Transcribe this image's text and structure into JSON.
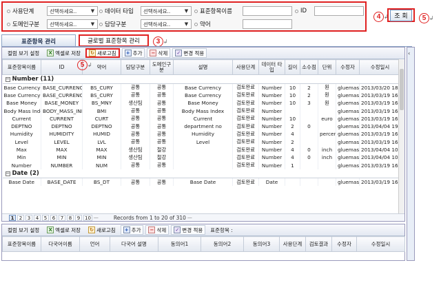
{
  "search": {
    "fields": [
      {
        "label": "사용단계",
        "type": "select",
        "value": "선택하세요.."
      },
      {
        "label": "데이터 타입",
        "type": "select",
        "value": "선택하세요.."
      },
      {
        "label": "표준항목이름",
        "type": "input",
        "value": ""
      },
      {
        "label": "ID",
        "type": "input",
        "value": ""
      },
      {
        "label": "도메인구분",
        "type": "select",
        "value": "선택하세요.."
      },
      {
        "label": "담당구분",
        "type": "select",
        "value": "선택하세요.."
      },
      {
        "label": "약어",
        "type": "input",
        "value": ""
      }
    ],
    "button_label": "조 회"
  },
  "callouts": {
    "c3": "3",
    "c4": "4",
    "c5a": "5",
    "c5b": "5"
  },
  "tabs": {
    "active": "표준항목 관리",
    "global": "글로벌 표준항목 관리"
  },
  "toolbar_top": {
    "view_settings": "컬럼 보기 설정",
    "excel_save": "엑셀로 저장",
    "refresh": "새로고침",
    "add": "추가",
    "delete": "삭제",
    "apply": "변경 적용"
  },
  "columns": [
    "표준항목이름",
    "ID",
    "약어",
    "담당구분",
    "도메인구분",
    "설명",
    "사용단계",
    "데이터 타입",
    "길이",
    "소수점",
    "단위",
    "수정자",
    "수정일시"
  ],
  "groups": [
    {
      "title": "Number (11)",
      "rows": [
        [
          "Base Currency",
          "BASE_CURRENCY",
          "BS_CURY",
          "공통",
          "공통",
          "Base Currency",
          "검토완료",
          "Number",
          "10",
          "2",
          "원",
          "gluemast",
          "2013/03/20 18:5"
        ],
        [
          "Base Currency3",
          "BASE_CURRENCY3",
          "BS_CURY",
          "공통",
          "공통",
          "Base Currency",
          "검토완료",
          "Number",
          "10",
          "2",
          "원",
          "gluemast",
          "2013/03/19 16:5"
        ],
        [
          "Base Money",
          "BASE_MONEY",
          "BS_MNY",
          "생산팀",
          "공통",
          "Base Money",
          "검토완료",
          "Number",
          "10",
          "3",
          "원",
          "gluemast",
          "2013/03/19 16:5"
        ],
        [
          "Body Mass Index",
          "BODY_MASS_INDEX",
          "BMI",
          "공통",
          "공통",
          "Body Mass Index",
          "검토완료",
          "Number",
          "",
          "",
          "",
          "gluemast",
          "2013/03/19 16:5"
        ],
        [
          "Current",
          "CURRENT",
          "CURT",
          "공통",
          "공통",
          "Current",
          "검토완료",
          "Number",
          "10",
          "",
          "euro",
          "gluemast",
          "2013/03/19 16:5"
        ],
        [
          "DEPTNO",
          "DEPTNO",
          "DEPTNO",
          "공통",
          "공통",
          "department no",
          "검토완료",
          "Number",
          "2",
          "0",
          "",
          "gluemast",
          "2013/04/04 19:5"
        ],
        [
          "Humidity",
          "HUMIDITY",
          "HUMID",
          "공통",
          "공통",
          "Humidity",
          "검토완료",
          "Number",
          "4",
          "",
          "percent",
          "gluemast",
          "2013/03/19 16:5"
        ],
        [
          "Level",
          "LEVEL",
          "LVL",
          "공통",
          "공통",
          "Level",
          "검토완료",
          "Number",
          "2",
          "",
          "",
          "gluemast",
          "2013/03/19 16:5"
        ],
        [
          "Max",
          "MAX",
          "MAX",
          "생산팀",
          "철강",
          "",
          "검토완료",
          "Number",
          "4",
          "0",
          "inch",
          "gluemast",
          "2013/04/04 10:5"
        ],
        [
          "Min",
          "MIN",
          "MIN",
          "생산팀",
          "철강",
          "",
          "검토완료",
          "Number",
          "4",
          "0",
          "inch",
          "gluemast",
          "2013/04/04 10:5"
        ],
        [
          "Number",
          "NUMBER",
          "NUM",
          "공통",
          "공통",
          "",
          "검토완료",
          "Number",
          "1",
          "",
          "",
          "gluemast",
          "2013/03/19 16:5"
        ]
      ]
    },
    {
      "title": "Date (2)",
      "rows": [
        [
          "Base Date",
          "BASE_DATE",
          "BS_DT",
          "공통",
          "공통",
          "Base Date",
          "검토완료",
          "Date",
          "",
          "",
          "",
          "gluemast",
          "2013/03/19 16:5"
        ]
      ]
    }
  ],
  "pager": {
    "pages": [
      "1",
      "2",
      "3",
      "4",
      "5",
      "6",
      "7",
      "8",
      "9",
      "10"
    ],
    "current": "1",
    "info": "Records from 1 to 20 of 310"
  },
  "toolbar_bottom": {
    "view_settings": "컬럼 보기 설정",
    "excel_save": "엑셀로 저장",
    "refresh": "새로고침",
    "add": "추가",
    "delete": "삭제",
    "apply": "변경 적용",
    "label": "표준항목 :"
  },
  "columns_bottom": [
    "표준항목이름",
    "다국어이름",
    "언어",
    "다국어 설명",
    "동의어1",
    "동의어2",
    "동의어3",
    "사용단계",
    "검토결과",
    "수정자",
    "수정일시"
  ]
}
